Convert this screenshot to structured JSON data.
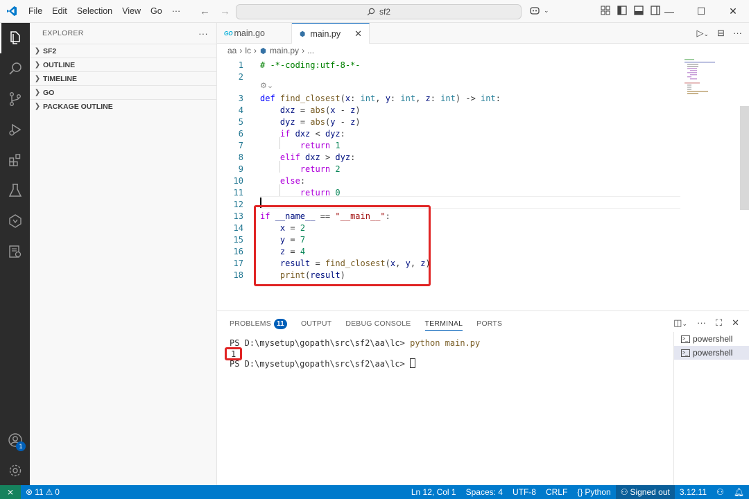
{
  "titlebar": {
    "menu": [
      "File",
      "Edit",
      "Selection",
      "View",
      "Go",
      "···"
    ],
    "search": "sf2",
    "window_controls": [
      "minimize",
      "maximize",
      "close"
    ]
  },
  "activitybar": {
    "items": [
      "explorer-icon",
      "search-icon",
      "source-control-icon",
      "run-debug-icon",
      "extensions-icon",
      "testing-icon",
      "remote-icon",
      "container-icon"
    ],
    "bottom": [
      "accounts-icon",
      "settings-icon"
    ],
    "accounts_badge": "1"
  },
  "sidebar": {
    "title": "EXPLORER",
    "more": "···",
    "sections": [
      "SF2",
      "OUTLINE",
      "TIMELINE",
      "GO",
      "PACKAGE OUTLINE"
    ]
  },
  "tabs": [
    {
      "label": "main.go",
      "icon": "GO"
    },
    {
      "label": "main.py",
      "active": true
    }
  ],
  "breadcrumb": [
    "aa",
    "lc",
    "main.py",
    "..."
  ],
  "editor": {
    "lines": [
      {
        "n": "1",
        "html": "<span class='cmt'># -*-coding:utf-8-*-</span>"
      },
      {
        "n": "2",
        "html": ""
      },
      {
        "n": "3",
        "html": "<span class='kw2'>def</span> <span class='fn'>find_closest</span>(<span class='var'>x</span>: <span class='ty'>int</span>, <span class='var'>y</span>: <span class='ty'>int</span>, <span class='var'>z</span>: <span class='ty'>int</span>) -> <span class='ty'>int</span>:"
      },
      {
        "n": "4",
        "html": "    <span class='var'>dxz</span> = <span class='fn'>abs</span>(<span class='var'>x</span> - <span class='var'>z</span>)"
      },
      {
        "n": "5",
        "html": "    <span class='var'>dyz</span> = <span class='fn'>abs</span>(<span class='var'>y</span> - <span class='var'>z</span>)"
      },
      {
        "n": "6",
        "html": "    <span class='kw'>if</span> <span class='var'>dxz</span> < <span class='var'>dyz</span>:"
      },
      {
        "n": "7",
        "html": "        <span class='kw'>return</span> <span class='num'>1</span>"
      },
      {
        "n": "8",
        "html": "    <span class='kw'>elif</span> <span class='var'>dxz</span> > <span class='var'>dyz</span>:"
      },
      {
        "n": "9",
        "html": "        <span class='kw'>return</span> <span class='num'>2</span>"
      },
      {
        "n": "10",
        "html": "    <span class='kw'>else</span>:"
      },
      {
        "n": "11",
        "html": "        <span class='kw'>return</span> <span class='num'>0</span>"
      },
      {
        "n": "12",
        "html": ""
      },
      {
        "n": "13",
        "html": "<span class='kw'>if</span> <span class='var'>__name__</span> == <span class='str'>\"__main__\"</span>:"
      },
      {
        "n": "14",
        "html": "    <span class='var'>x</span> = <span class='num'>2</span>"
      },
      {
        "n": "15",
        "html": "    <span class='var'>y</span> = <span class='num'>7</span>"
      },
      {
        "n": "16",
        "html": "    <span class='var'>z</span> = <span class='num'>4</span>"
      },
      {
        "n": "17",
        "html": "    <span class='var'>result</span> = <span class='fn'>find_closest</span>(<span class='var'>x</span>, <span class='var'>y</span>, <span class='var'>z</span>)"
      },
      {
        "n": "18",
        "html": "    <span class='fn'>print</span>(<span class='var'>result</span>)"
      }
    ]
  },
  "panel": {
    "tabs": [
      "PROBLEMS",
      "OUTPUT",
      "DEBUG CONSOLE",
      "TERMINAL",
      "PORTS"
    ],
    "problems_count": "11",
    "terminal": {
      "line1_prompt": "PS D:\\mysetup\\gopath\\src\\sf2\\aa\\lc> ",
      "line1_cmd": "python main.py",
      "output": "1",
      "line3_prompt": "PS D:\\mysetup\\gopath\\src\\sf2\\aa\\lc> "
    },
    "terminals": [
      "powershell",
      "powershell"
    ]
  },
  "statusbar": {
    "errors": "11",
    "warnings": "0",
    "position": "Ln 12, Col 1",
    "spaces": "Spaces: 4",
    "encoding": "UTF-8",
    "eol": "CRLF",
    "language": "Python",
    "account": "Signed out",
    "version": "3.12.11"
  }
}
